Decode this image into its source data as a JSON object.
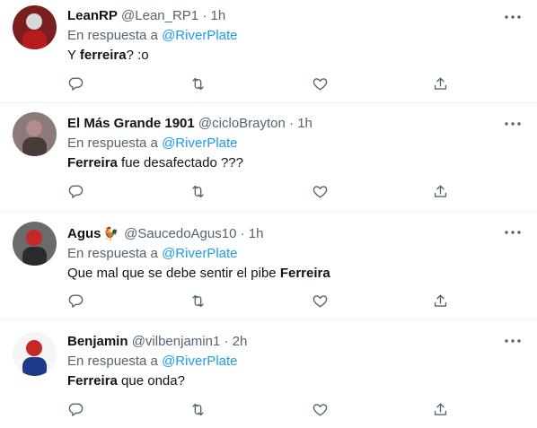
{
  "reply_prefix": "En respuesta a",
  "tweets": [
    {
      "name": "LeanRP",
      "handle": "@Lean_RP1",
      "sep": "·",
      "time": "1h",
      "reply_to": "@RiverPlate",
      "text_parts": [
        {
          "t": "Y ",
          "b": false
        },
        {
          "t": "ferreira",
          "b": true
        },
        {
          "t": "? :o",
          "b": false
        }
      ],
      "avatar_colors": [
        "#7a1f1f",
        "#d9d9d9",
        "#b71c1c"
      ]
    },
    {
      "name": "El Más Grande 1901",
      "handle": "@cicloBrayton",
      "sep": "·",
      "time": "1h",
      "reply_to": "@RiverPlate",
      "text_parts": [
        {
          "t": "Ferreira",
          "b": true
        },
        {
          "t": " fue desafectado ???",
          "b": false
        }
      ],
      "avatar_colors": [
        "#8c7a7a",
        "#b38c8c",
        "#4a3b3b"
      ]
    },
    {
      "name": "Agus",
      "emoji": "🐓",
      "handle": "@SaucedoAgus10",
      "sep": "·",
      "time": "1h",
      "reply_to": "@RiverPlate",
      "text_parts": [
        {
          "t": "Que mal que se debe sentir el pibe ",
          "b": false
        },
        {
          "t": "Ferreira",
          "b": true
        }
      ],
      "avatar_colors": [
        "#6b6b6b",
        "#c62828",
        "#2b2b2b"
      ]
    },
    {
      "name": "Benjamin",
      "handle": "@vilbenjamin1",
      "sep": "·",
      "time": "2h",
      "reply_to": "@RiverPlate",
      "text_parts": [
        {
          "t": "Ferreira",
          "b": true
        },
        {
          "t": " que onda?",
          "b": false
        }
      ],
      "avatar_colors": [
        "#f5f5f5",
        "#c62828",
        "#1e3a8a"
      ]
    }
  ],
  "icons": [
    "reply-icon",
    "retweet-icon",
    "like-icon",
    "share-icon",
    "more-options-icon"
  ],
  "colors": {
    "text": "#0f1419",
    "secondary": "#536471",
    "link": "#1d9bf0",
    "divider": "#eff3f4"
  }
}
